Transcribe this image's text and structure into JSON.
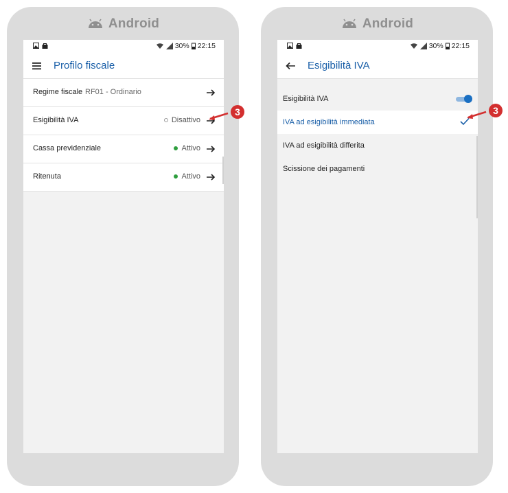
{
  "left_phone": {
    "os_label": "Android",
    "status": {
      "battery": "30%",
      "time": "22:15"
    },
    "title": "Profilo fiscale",
    "rows": [
      {
        "label": "Regime fiscale",
        "sub": "RF01 - Ordinario",
        "status": ""
      },
      {
        "label": "Esigibilità IVA",
        "sub": "",
        "status": "Disattivo",
        "state": "off"
      },
      {
        "label": "Cassa previdenziale",
        "sub": "",
        "status": "Attivo",
        "state": "on"
      },
      {
        "label": "Ritenuta",
        "sub": "",
        "status": "Attivo",
        "state": "on"
      }
    ]
  },
  "right_phone": {
    "os_label": "Android",
    "status": {
      "battery": "30%",
      "time": "22:15"
    },
    "title": "Esigibilità IVA",
    "toggle_label": "Esigibilità IVA",
    "toggle_on": true,
    "options": [
      {
        "label": "IVA ad esigibilità immediata",
        "selected": true
      },
      {
        "label": "IVA ad esigibilità differita",
        "selected": false
      },
      {
        "label": "Scissione dei pagamenti",
        "selected": false
      }
    ]
  },
  "callouts": [
    "3",
    "3"
  ],
  "colors": {
    "accent": "#1a5fa8",
    "active": "#2e9e3e",
    "callout": "#d32f2f"
  }
}
